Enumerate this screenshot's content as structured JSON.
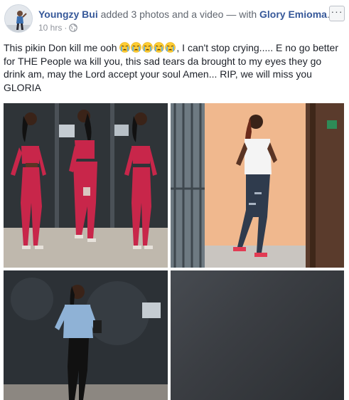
{
  "post": {
    "author": "Youngzy Bui",
    "action": "added 3 photos and a video — with",
    "tagged": "Glory Emioma",
    "period": ".",
    "timestamp": "10 hrs",
    "text_before_emoji": "This pikin Don kill me ooh ",
    "text_after_emoji": ", I can't stop crying..... E no go better for THE People wa kill you, this sad tears da brought to my eyes they go drink am, may the Lord accept your soul Amen... RIP, we will miss you GLORIA",
    "emoji_count": 5,
    "emoji_name": "crying-face-icon",
    "more_label": "···"
  },
  "colors": {
    "link": "#365899",
    "meta": "#90949c",
    "text": "#1d2129",
    "emoji_face": "#ffcc33",
    "emoji_tears": "#5dadec"
  },
  "media": [
    {
      "type": "photo",
      "subject": "woman in red outfit, three poses"
    },
    {
      "type": "photo",
      "subject": "woman in white top and ripped jeans"
    },
    {
      "type": "photo",
      "subject": "woman in denim jacket"
    },
    {
      "type": "video",
      "subject": "dark video thumbnail"
    }
  ]
}
